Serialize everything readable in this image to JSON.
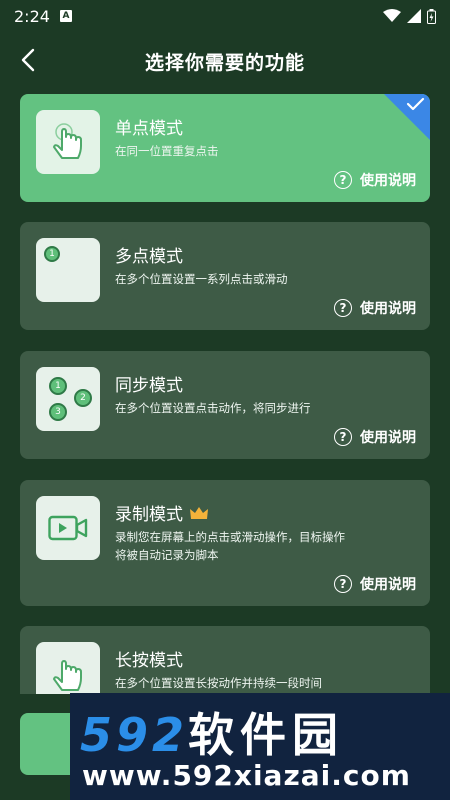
{
  "status_bar": {
    "time": "2:24",
    "notification_icon": "A"
  },
  "header": {
    "title": "选择你需要的功能"
  },
  "help_label": "使用说明",
  "modes": [
    {
      "name": "单点模式",
      "desc": "在同一位置重复点击",
      "selected": true
    },
    {
      "name": "多点模式",
      "desc": "在多个位置设置一系列点击或滑动",
      "selected": false
    },
    {
      "name": "同步模式",
      "desc": "在多个位置设置点击动作，将同步进行",
      "selected": false
    },
    {
      "name": "录制模式",
      "desc_line1": "录制您在屏幕上的点击或滑动操作，目标操作",
      "desc_line2": "将被自动记录为脚本",
      "premium": true,
      "selected": false
    },
    {
      "name": "长按模式",
      "desc": "在多个位置设置长按动作并持续一段时间",
      "selected": false
    }
  ],
  "watermark": {
    "number": "592",
    "brand": "软件园",
    "url": "www.592xiazai.com"
  },
  "colors": {
    "background": "#1c3a25",
    "card": "#3e5b46",
    "selected_card": "#63c281",
    "check_corner": "#3b87e6"
  }
}
